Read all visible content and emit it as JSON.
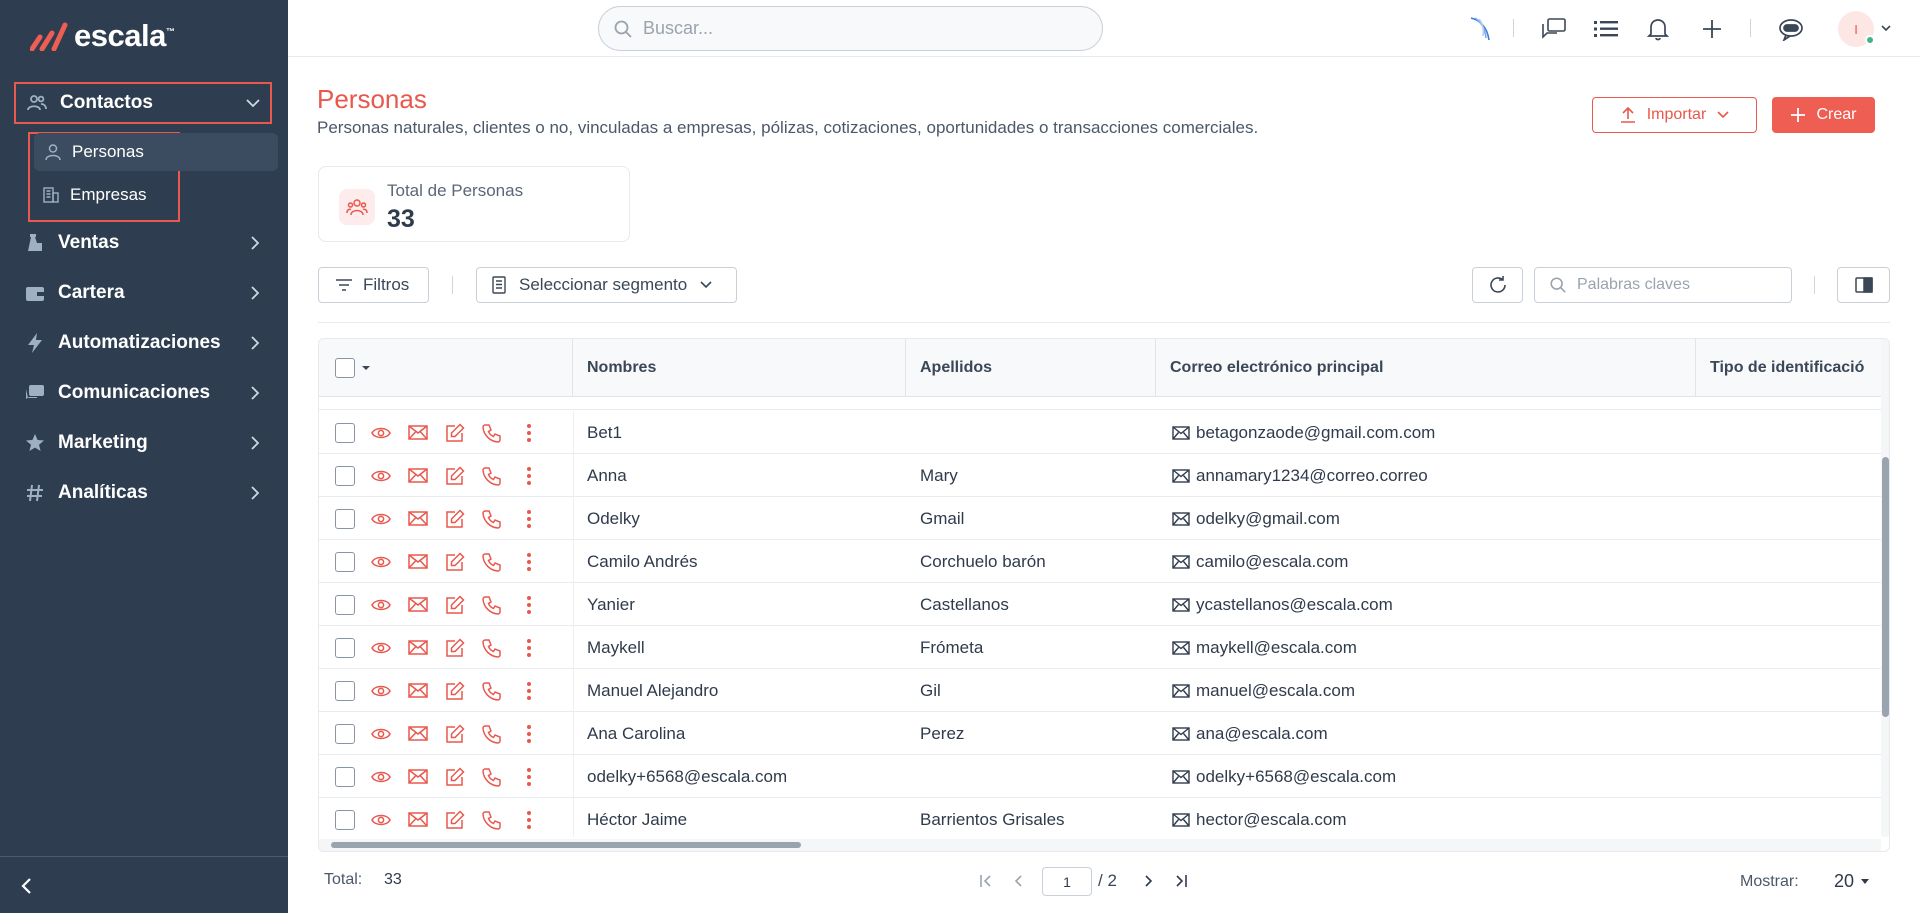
{
  "app": {
    "logo_text": "escala",
    "logo_tm": "™"
  },
  "search": {
    "placeholder": "Buscar..."
  },
  "user": {
    "avatar_initial": "I"
  },
  "sidebar": {
    "items": [
      {
        "label": "Contactos",
        "icon": "users-icon"
      },
      {
        "label": "Ventas",
        "icon": "sales-icon"
      },
      {
        "label": "Cartera",
        "icon": "wallet-icon"
      },
      {
        "label": "Automatizaciones",
        "icon": "bolt-icon"
      },
      {
        "label": "Comunicaciones",
        "icon": "chat-icon"
      },
      {
        "label": "Marketing",
        "icon": "star-icon"
      },
      {
        "label": "Analíticas",
        "icon": "hash-icon"
      }
    ],
    "sub_items": [
      {
        "label": "Personas",
        "icon": "person-icon"
      },
      {
        "label": "Empresas",
        "icon": "building-icon"
      }
    ]
  },
  "page": {
    "title": "Personas",
    "subtitle": "Personas naturales, clientes o no, vinculadas a empresas, pólizas, cotizaciones, oportunidades o transacciones comerciales.",
    "import_label": "Importar",
    "create_label": "Crear"
  },
  "stat": {
    "label": "Total de Personas",
    "value": "33"
  },
  "toolbar": {
    "filters_label": "Filtros",
    "segment_label": "Seleccionar segmento",
    "keywords_placeholder": "Palabras claves"
  },
  "table": {
    "columns": [
      "Nombres",
      "Apellidos",
      "Correo electrónico principal",
      "Tipo de identificació"
    ],
    "rows": [
      {
        "nombres": "Bet1",
        "apellidos": "",
        "correo": "betagonzaode@gmail.com.com"
      },
      {
        "nombres": "Anna",
        "apellidos": "Mary",
        "correo": "annamary1234@correo.correo"
      },
      {
        "nombres": "Odelky",
        "apellidos": "Gmail",
        "correo": "odelky@gmail.com"
      },
      {
        "nombres": "Camilo Andrés",
        "apellidos": "Corchuelo barón",
        "correo": "camilo@escala.com"
      },
      {
        "nombres": "Yanier",
        "apellidos": "Castellanos",
        "correo": "ycastellanos@escala.com"
      },
      {
        "nombres": "Maykell",
        "apellidos": "Frómeta",
        "correo": "maykell@escala.com"
      },
      {
        "nombres": "Manuel Alejandro",
        "apellidos": "Gil",
        "correo": "manuel@escala.com"
      },
      {
        "nombres": "Ana Carolina",
        "apellidos": "Perez",
        "correo": "ana@escala.com"
      },
      {
        "nombres": "odelky+6568@escala.com",
        "apellidos": "",
        "correo": "odelky+6568@escala.com"
      },
      {
        "nombres": "Héctor Jaime",
        "apellidos": "Barrientos Grisales",
        "correo": "hector@escala.com"
      }
    ]
  },
  "footer": {
    "total_label": "Total:",
    "total_value": "33",
    "page_current": "1",
    "page_of": "/ 2",
    "show_label": "Mostrar:",
    "show_value": "20"
  },
  "colors": {
    "accent": "#e8584d",
    "sidebar_bg": "#2e3e50"
  }
}
